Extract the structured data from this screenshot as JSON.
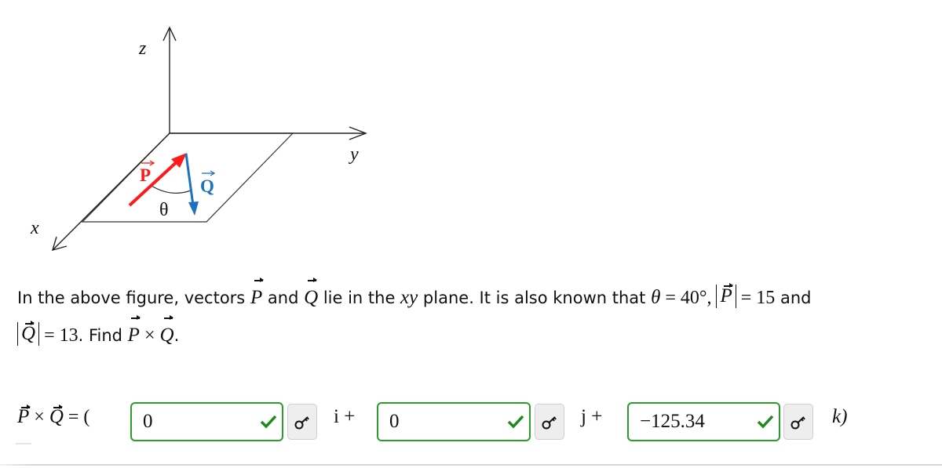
{
  "figure": {
    "axis_labels": {
      "x": "x",
      "y": "y",
      "z": "z"
    },
    "vector_p_label": "P",
    "vector_q_label": "Q",
    "angle_label": "θ",
    "colors": {
      "vector_p": "#ff1a1a",
      "vector_q": "#1a72c0",
      "axes": "#222222"
    }
  },
  "problem": {
    "line1_part1": "In the above figure, vectors ",
    "vec_p": "P",
    "and": " and ",
    "vec_q": "Q",
    "line1_part2": " lie in the ",
    "plane_var": "xy",
    "line1_part3": " plane. It is also known that ",
    "theta_symbol": "θ",
    "eq1": " = 40°, ",
    "eq2": " = 15",
    "line1_end": " and",
    "eq3": " = 13",
    "line2_part": ". Find ",
    "times": " × ",
    "period": "."
  },
  "answer": {
    "lhs_p": "P",
    "lhs_times": " × ",
    "lhs_q": "Q",
    "lhs_eq": " = (",
    "fields": [
      {
        "value": "0",
        "status": "correct",
        "unit_suffix": "i +"
      },
      {
        "value": "0",
        "status": "correct",
        "unit_suffix": "j +"
      },
      {
        "value": "−125.34",
        "status": "correct",
        "unit_suffix": "k)"
      }
    ],
    "colors": {
      "correct_border": "#2a9d2a",
      "check": "#1e8a1e",
      "key_bg": "#eeeeee"
    }
  }
}
